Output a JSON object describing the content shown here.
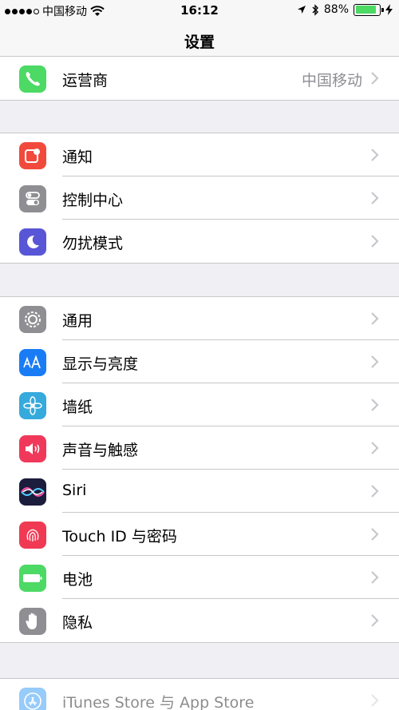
{
  "status_bar": {
    "carrier": "中国移动",
    "time": "16:12",
    "battery_percent": "88%",
    "battery_level": 0.88,
    "signal_bars_filled": 4,
    "signal_bars_total": 5
  },
  "nav": {
    "title": "设置"
  },
  "carrier_row": {
    "label": "运营商",
    "value": "中国移动",
    "icon": "phone-icon",
    "color": "#4cd964"
  },
  "group1": [
    {
      "label": "通知",
      "icon": "notification-icon",
      "color": "#f14a3c"
    },
    {
      "label": "控制中心",
      "icon": "control-center-icon",
      "color": "#8e8e93"
    },
    {
      "label": "勿扰模式",
      "icon": "moon-icon",
      "color": "#5856d6"
    }
  ],
  "group2": [
    {
      "label": "通用",
      "icon": "gear-icon",
      "color": "#8e8e93"
    },
    {
      "label": "显示与亮度",
      "icon": "display-brightness-icon",
      "color": "#1a7cf5"
    },
    {
      "label": "墙纸",
      "icon": "wallpaper-flower-icon",
      "color": "#36aadc"
    },
    {
      "label": "声音与触感",
      "icon": "speaker-icon",
      "color": "#f0395a"
    },
    {
      "label": "Siri",
      "icon": "siri-icon",
      "color": "#1c1c3c"
    },
    {
      "label": "Touch ID 与密码",
      "icon": "fingerprint-icon",
      "color": "#f03a54"
    },
    {
      "label": "电池",
      "icon": "battery-icon",
      "color": "#4cd964"
    },
    {
      "label": "隐私",
      "icon": "hand-icon",
      "color": "#8e8e93"
    }
  ],
  "group3": [
    {
      "label": "iTunes Store 与 App Store",
      "icon": "app-store-icon",
      "color": "#1a8ef5"
    }
  ]
}
